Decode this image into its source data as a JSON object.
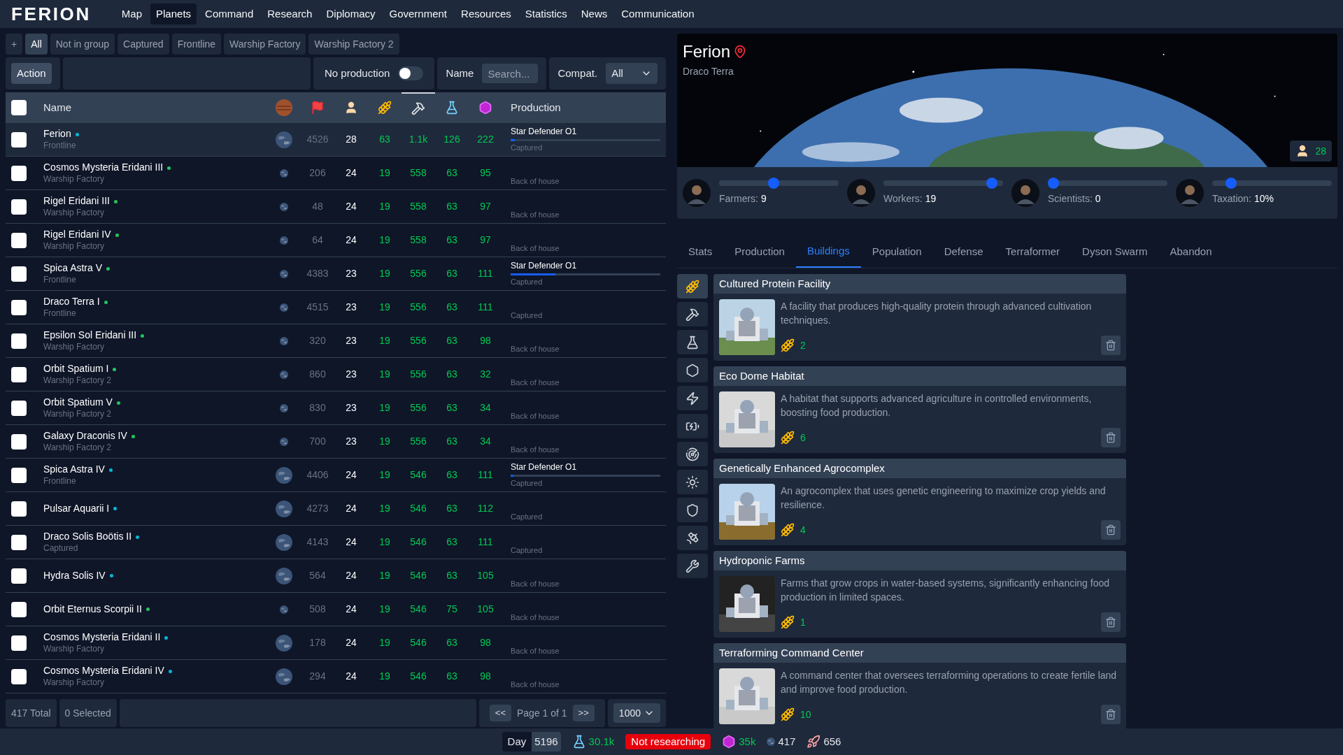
{
  "logo": "FERION",
  "nav": [
    {
      "label": "Map",
      "selected": false
    },
    {
      "label": "Planets",
      "selected": true
    },
    {
      "label": "Command",
      "selected": false
    },
    {
      "label": "Research",
      "selected": false
    },
    {
      "label": "Diplomacy",
      "selected": false
    },
    {
      "label": "Government",
      "selected": false
    },
    {
      "label": "Resources",
      "selected": false
    },
    {
      "label": "Statistics",
      "selected": false
    },
    {
      "label": "News",
      "selected": false
    },
    {
      "label": "Communication",
      "selected": false
    }
  ],
  "groups": [
    {
      "label": "+",
      "selected": false
    },
    {
      "label": "All",
      "selected": true
    },
    {
      "label": "Not in group",
      "selected": false
    },
    {
      "label": "Captured",
      "selected": false
    },
    {
      "label": "Frontline",
      "selected": false
    },
    {
      "label": "Warship Factory",
      "selected": false
    },
    {
      "label": "Warship Factory 2",
      "selected": false
    }
  ],
  "toolbar": {
    "action": "Action",
    "no_production": {
      "label": "No production",
      "on": false
    },
    "name_label": "Name",
    "search": {
      "placeholder": "Search..."
    },
    "compat_label": "Compat.",
    "compat_value": "All"
  },
  "table": {
    "all_checked": false,
    "columns": [
      {
        "kind": "check"
      },
      {
        "kind": "name",
        "label": "Name"
      },
      {
        "kind": "planet",
        "sorted": false
      },
      {
        "kind": "flag",
        "sorted": false
      },
      {
        "kind": "pop",
        "sorted": false
      },
      {
        "kind": "food",
        "sorted": false
      },
      {
        "kind": "industry",
        "sorted": true
      },
      {
        "kind": "science",
        "sorted": false
      },
      {
        "kind": "credits",
        "sorted": false
      },
      {
        "kind": "production",
        "label": "Production"
      }
    ],
    "rows": [
      {
        "name": "Ferion",
        "color": "#06b6d4",
        "group": "Frontline",
        "big": true,
        "selected": true,
        "checked": false,
        "values": [
          "4526",
          "28",
          "63",
          "1.1k",
          "126",
          "222"
        ],
        "item": "Star Defender O1",
        "level": 0.03,
        "status": "Captured"
      },
      {
        "name": "Cosmos Mysteria Eridani III",
        "color": "#22c55e",
        "group": "Warship Factory",
        "big": false,
        "selected": false,
        "checked": false,
        "values": [
          "206",
          "24",
          "19",
          "558",
          "63",
          "95"
        ],
        "status": "Back of house"
      },
      {
        "name": "Rigel Eridani III",
        "color": "#22c55e",
        "group": "Warship Factory",
        "big": false,
        "selected": false,
        "checked": false,
        "values": [
          "48",
          "24",
          "19",
          "558",
          "63",
          "97"
        ],
        "status": "Back of house"
      },
      {
        "name": "Rigel Eridani IV",
        "color": "#22c55e",
        "group": "Warship Factory",
        "big": false,
        "selected": false,
        "checked": false,
        "values": [
          "64",
          "24",
          "19",
          "558",
          "63",
          "97"
        ],
        "status": "Back of house"
      },
      {
        "name": "Spica Astra V",
        "color": "#22c55e",
        "group": "Frontline",
        "big": false,
        "selected": false,
        "checked": false,
        "values": [
          "4383",
          "23",
          "19",
          "556",
          "63",
          "111"
        ],
        "item": "Star Defender O1",
        "level": 0.3,
        "status": "Captured"
      },
      {
        "name": "Draco Terra I",
        "color": "#22c55e",
        "group": "Frontline",
        "big": false,
        "selected": false,
        "checked": false,
        "values": [
          "4515",
          "23",
          "19",
          "556",
          "63",
          "111"
        ],
        "status": "Captured"
      },
      {
        "name": "Epsilon Sol Eridani III",
        "color": "#22c55e",
        "group": "Warship Factory",
        "big": false,
        "selected": false,
        "checked": false,
        "values": [
          "320",
          "23",
          "19",
          "556",
          "63",
          "98"
        ],
        "status": "Back of house"
      },
      {
        "name": "Orbit Spatium I",
        "color": "#22c55e",
        "group": "Warship Factory 2",
        "big": false,
        "selected": false,
        "checked": false,
        "values": [
          "860",
          "23",
          "19",
          "556",
          "63",
          "32"
        ],
        "status": "Back of house"
      },
      {
        "name": "Orbit Spatium V",
        "color": "#22c55e",
        "group": "Warship Factory 2",
        "big": false,
        "selected": false,
        "checked": false,
        "values": [
          "830",
          "23",
          "19",
          "556",
          "63",
          "34"
        ],
        "status": "Back of house"
      },
      {
        "name": "Galaxy Draconis IV",
        "color": "#22c55e",
        "group": "Warship Factory 2",
        "big": false,
        "selected": false,
        "checked": false,
        "values": [
          "700",
          "23",
          "19",
          "556",
          "63",
          "34"
        ],
        "status": "Back of house"
      },
      {
        "name": "Spica Astra IV",
        "color": "#06b6d4",
        "group": "Frontline",
        "big": true,
        "selected": false,
        "checked": false,
        "values": [
          "4406",
          "24",
          "19",
          "546",
          "63",
          "111"
        ],
        "item": "Star Defender O1",
        "level": 0.02,
        "status": "Captured"
      },
      {
        "name": "Pulsar Aquarii I",
        "color": "#06b6d4",
        "big": true,
        "selected": false,
        "checked": false,
        "values": [
          "4273",
          "24",
          "19",
          "546",
          "63",
          "112"
        ],
        "status": "Captured"
      },
      {
        "name": "Draco Solis Boötis II",
        "color": "#06b6d4",
        "group": "Captured",
        "big": true,
        "selected": false,
        "checked": false,
        "values": [
          "4143",
          "24",
          "19",
          "546",
          "63",
          "111"
        ],
        "status": "Captured"
      },
      {
        "name": "Hydra Solis IV",
        "color": "#06b6d4",
        "big": true,
        "selected": false,
        "checked": false,
        "values": [
          "564",
          "24",
          "19",
          "546",
          "63",
          "105"
        ],
        "status": "Back of house"
      },
      {
        "name": "Orbit Eternus Scorpii II",
        "color": "#22c55e",
        "big": false,
        "selected": false,
        "checked": false,
        "values": [
          "508",
          "24",
          "19",
          "546",
          "75",
          "105"
        ],
        "status": "Back of house"
      },
      {
        "name": "Cosmos Mysteria Eridani II",
        "color": "#06b6d4",
        "group": "Warship Factory",
        "big": true,
        "selected": false,
        "checked": false,
        "values": [
          "178",
          "24",
          "19",
          "546",
          "63",
          "98"
        ],
        "status": "Back of house"
      },
      {
        "name": "Cosmos Mysteria Eridani IV",
        "color": "#06b6d4",
        "group": "Warship Factory",
        "big": true,
        "selected": false,
        "checked": false,
        "values": [
          "294",
          "24",
          "19",
          "546",
          "63",
          "98"
        ],
        "status": "Back of house"
      }
    ]
  },
  "footer": {
    "total": "417 Total",
    "selected": "0 Selected",
    "prev": "<<",
    "page": "Page 1 of 1",
    "next": ">>",
    "per_page": "1000"
  },
  "planet": {
    "name": "Ferion",
    "system": "Draco Terra",
    "population": "28",
    "sliders": [
      {
        "label": "Farmers:",
        "value": "9",
        "level": 0.45
      },
      {
        "label": "Workers:",
        "value": "19",
        "level": 0.95
      },
      {
        "label": "Scientists:",
        "value": "0",
        "level": 0.0
      },
      {
        "label": "Taxation:",
        "value": "10%",
        "level": 0.12
      }
    ]
  },
  "tabs": [
    {
      "label": "Stats",
      "selected": false
    },
    {
      "label": "Production",
      "selected": false
    },
    {
      "label": "Buildings",
      "selected": true
    },
    {
      "label": "Population",
      "selected": false
    },
    {
      "label": "Defense",
      "selected": false
    },
    {
      "label": "Terraformer",
      "selected": false
    },
    {
      "label": "Dyson Swarm",
      "selected": false
    },
    {
      "label": "Abandon",
      "selected": false
    }
  ],
  "categories": [
    {
      "kind": "food",
      "selected": true
    },
    {
      "kind": "industry",
      "selected": false
    },
    {
      "kind": "science",
      "selected": false
    },
    {
      "kind": "credits",
      "selected": false
    },
    {
      "kind": "energy",
      "selected": false
    },
    {
      "kind": "battery",
      "selected": false
    },
    {
      "kind": "radar",
      "selected": false
    },
    {
      "kind": "star",
      "selected": false
    },
    {
      "kind": "shield",
      "selected": false
    },
    {
      "kind": "satellite",
      "selected": false
    },
    {
      "kind": "tools",
      "selected": false
    }
  ],
  "buildings": [
    {
      "title": "Cultured Protein Facility",
      "description": "A facility that produces high-quality protein through advanced cultivation techniques.",
      "count": "2"
    },
    {
      "title": "Eco Dome Habitat",
      "description": "A habitat that supports advanced agriculture in controlled environments, boosting food production.",
      "count": "6"
    },
    {
      "title": "Genetically Enhanced Agrocomplex",
      "description": "An agrocomplex that uses genetic engineering to maximize crop yields and resilience.",
      "count": "4"
    },
    {
      "title": "Hydroponic Farms",
      "description": "Farms that grow crops in water-based systems, significantly enhancing food production in limited spaces.",
      "count": "1"
    },
    {
      "title": "Terraforming Command Center",
      "description": "A command center that oversees terraforming operations to create fertile land and improve food production.",
      "count": "10"
    }
  ],
  "status_bar": {
    "day_label": "Day",
    "day": "5196",
    "science": "30.1k",
    "research": "Not researching",
    "credits": "35k",
    "planets": "417",
    "ships": "656"
  }
}
